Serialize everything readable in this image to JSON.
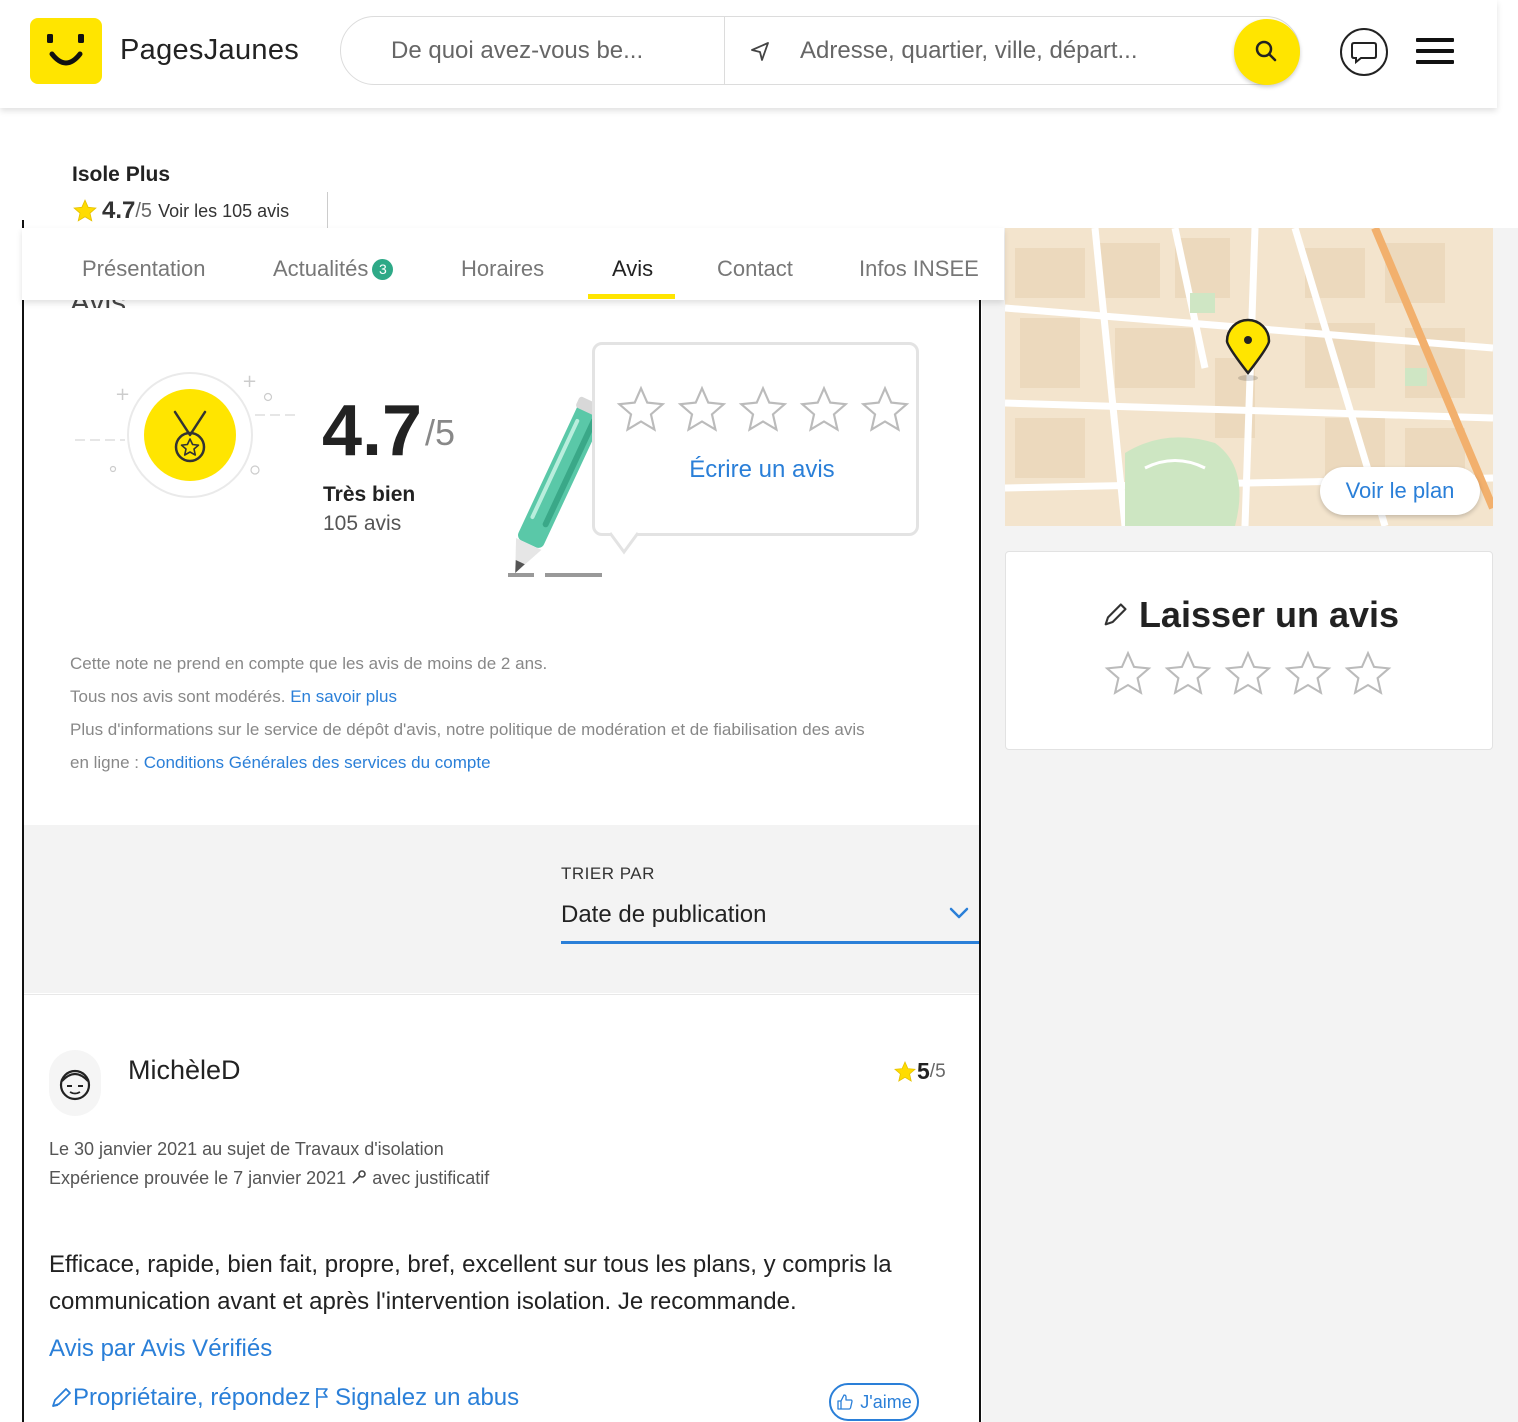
{
  "header": {
    "logo_text": "PagesJaunes",
    "search_what_placeholder": "De quoi avez-vous be...",
    "search_where_placeholder": "Adresse, quartier, ville, départ..."
  },
  "business": {
    "name": "Isole Plus",
    "rating": "4.7",
    "rating_of": "/5",
    "reviews_link": "Voir les 105 avis"
  },
  "tabs": [
    {
      "label": "Présentation",
      "active": false
    },
    {
      "label": "Actualités",
      "badge": "3",
      "active": false
    },
    {
      "label": "Horaires",
      "active": false
    },
    {
      "label": "Avis",
      "active": true
    },
    {
      "label": "Contact",
      "active": false
    },
    {
      "label": "Infos INSEE",
      "active": false
    }
  ],
  "summary": {
    "score": "4.7",
    "score_of": "/5",
    "label": "Très bien",
    "count": "105 avis",
    "write_review": "Écrire un avis"
  },
  "notes": {
    "line1": "Cette note ne prend en compte que les avis de moins de 2 ans.",
    "line2_text": "Tous nos avis sont modérés.",
    "line2_link": "En savoir plus",
    "line3": "Plus d'informations sur le service de dépôt d'avis, notre politique de modération et de fiabilisation des avis",
    "line4_text": "en ligne :",
    "line4_link": "Conditions Générales des services du compte"
  },
  "sort": {
    "label": "TRIER PAR",
    "value": "Date de publication"
  },
  "review": {
    "author": "MichèleD",
    "rating": "5",
    "rating_of": "/5",
    "date_line": "Le 30 janvier 2021 au sujet de Travaux d'isolation",
    "proof_line_a": "Expérience prouvée le 7 janvier 2021",
    "proof_line_b": "avec justificatif",
    "text": "Efficace, rapide, bien fait, propre, bref, excellent sur tous les plans, y compris la communication avant et après l'intervention isolation. Je recommande.",
    "source_link": "Avis par Avis Vérifiés",
    "reply_link": "Propriétaire, répondez",
    "report_link": "Signalez un abus",
    "like_label": "J'aime"
  },
  "sidebar": {
    "map_button": "Voir le plan",
    "leave_review_title": "Laisser un avis"
  },
  "colors": {
    "brand_yellow": "#ffe500",
    "link_blue": "#2a7fd8",
    "badge_green": "#2ea987",
    "pen_green": "#5ac8a8"
  }
}
